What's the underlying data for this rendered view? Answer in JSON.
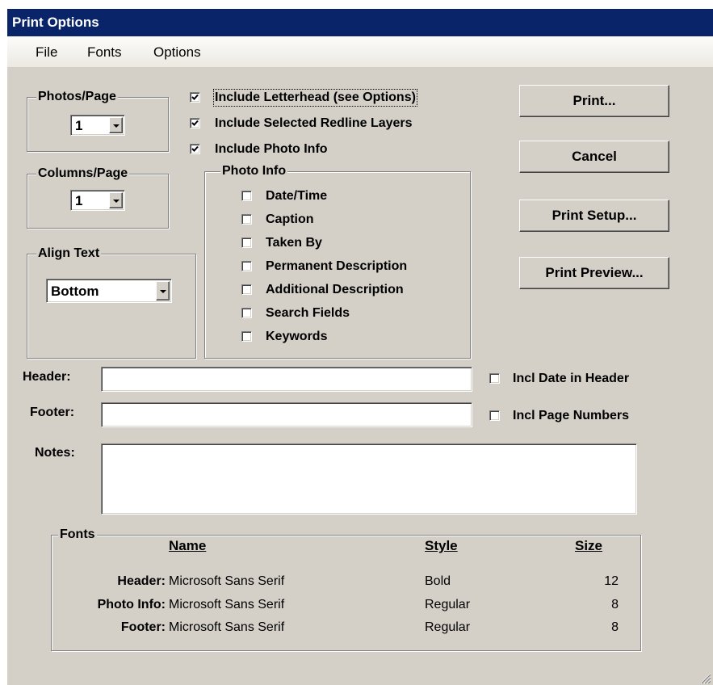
{
  "window": {
    "title": "Print Options"
  },
  "menu": [
    "File",
    "Fonts",
    "Options"
  ],
  "photos_per_page": {
    "label": "Photos/Page",
    "value": "1"
  },
  "columns_per_page": {
    "label": "Columns/Page",
    "value": "1"
  },
  "align_text": {
    "label": "Align Text",
    "value": "Bottom"
  },
  "include_options": [
    {
      "label": "Include Letterhead (see Options)",
      "checked": true
    },
    {
      "label": "Include Selected Redline Layers",
      "checked": true
    },
    {
      "label": "Include Photo Info",
      "checked": true
    }
  ],
  "photo_info": {
    "label": "Photo Info",
    "items": [
      {
        "label": "Date/Time",
        "checked": false
      },
      {
        "label": "Caption",
        "checked": false
      },
      {
        "label": "Taken By",
        "checked": false
      },
      {
        "label": "Permanent Description",
        "checked": false
      },
      {
        "label": "Additional Description",
        "checked": false
      },
      {
        "label": "Search Fields",
        "checked": false
      },
      {
        "label": "Keywords",
        "checked": false
      }
    ]
  },
  "buttons": {
    "print": "Print...",
    "cancel": "Cancel",
    "print_setup": "Print Setup...",
    "print_preview": "Print Preview..."
  },
  "header": {
    "label": "Header:",
    "value": "",
    "incl_label": "Incl Date in Header",
    "incl_checked": false
  },
  "footer": {
    "label": "Footer:",
    "value": "",
    "incl_label": "Incl Page Numbers",
    "incl_checked": false
  },
  "notes": {
    "label": "Notes:",
    "value": ""
  },
  "fonts": {
    "label": "Fonts",
    "columns": {
      "name": "Name",
      "style": "Style",
      "size": "Size"
    },
    "rows": [
      {
        "target": "Header:",
        "name": "Microsoft Sans Serif",
        "style": "Bold",
        "size": "12"
      },
      {
        "target": "Photo Info:",
        "name": "Microsoft Sans Serif",
        "style": "Regular",
        "size": "8"
      },
      {
        "target": "Footer:",
        "name": "Microsoft Sans Serif",
        "style": "Regular",
        "size": "8"
      }
    ]
  }
}
